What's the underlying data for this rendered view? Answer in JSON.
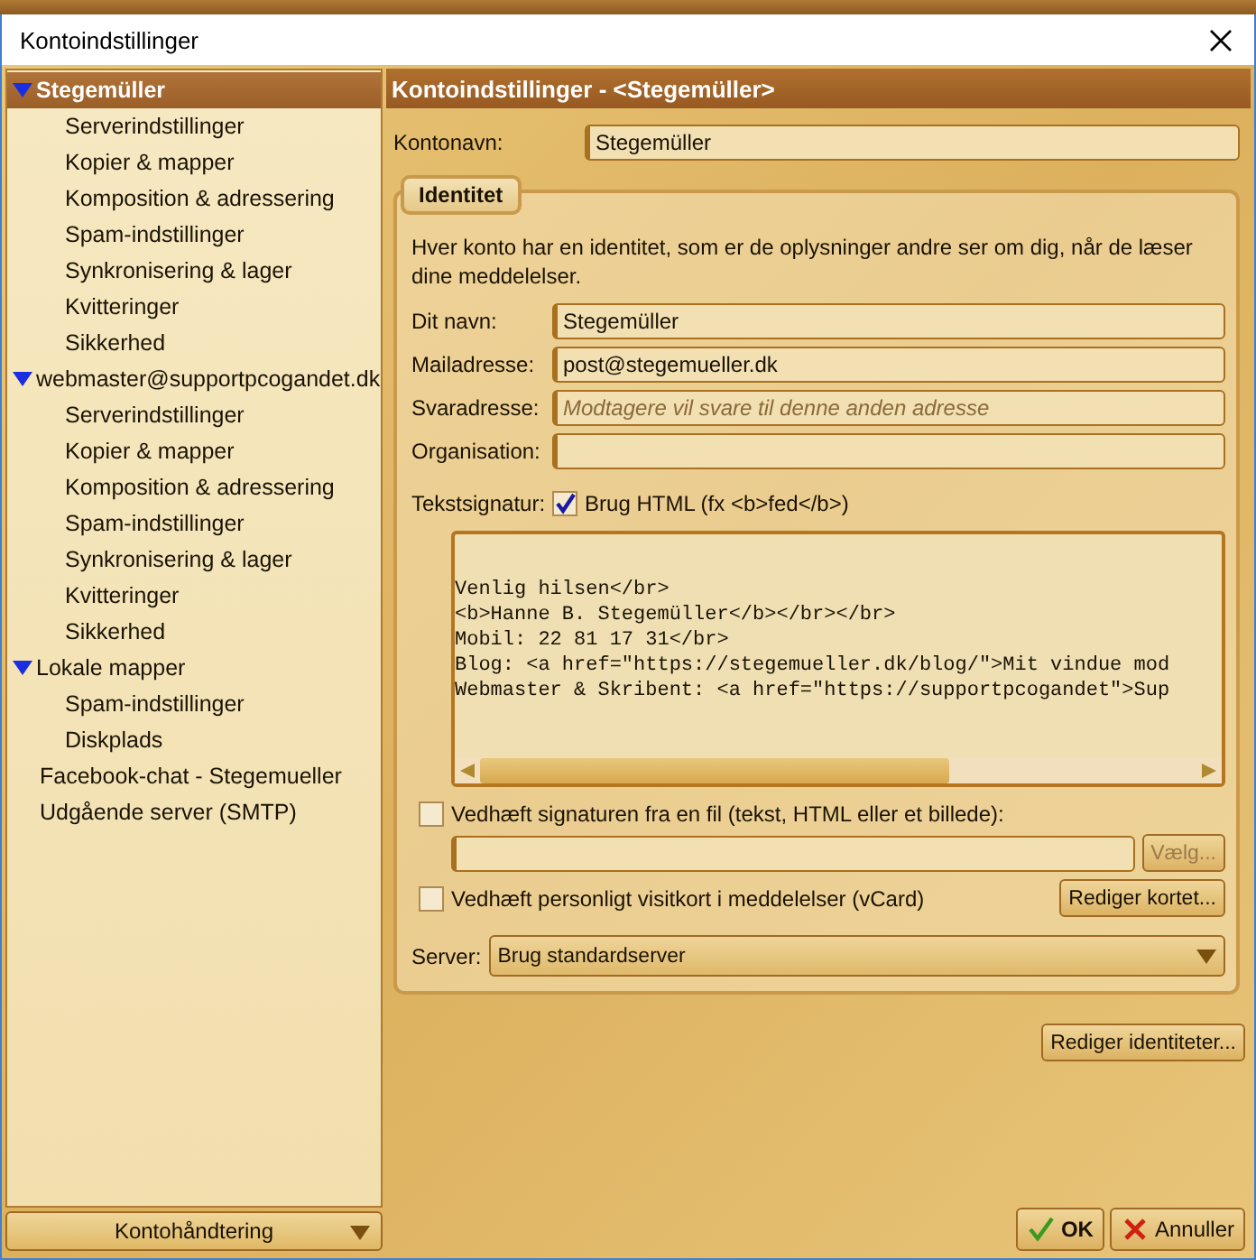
{
  "window": {
    "title": "Kontoindstillinger"
  },
  "sidebar": {
    "tree": [
      {
        "label": "Stegemüller",
        "expanded": true,
        "selected": true,
        "children": [
          {
            "label": "Serverindstillinger",
            "selected": false
          },
          {
            "label": "Kopier & mapper",
            "selected": false
          },
          {
            "label": "Komposition & adressering",
            "selected": false
          },
          {
            "label": "Spam-indstillinger",
            "selected": false
          },
          {
            "label": "Synkronisering & lager",
            "selected": false
          },
          {
            "label": "Kvitteringer",
            "selected": false
          },
          {
            "label": "Sikkerhed",
            "selected": false
          }
        ]
      },
      {
        "label": "webmaster@supportpcogandet.dk",
        "expanded": true,
        "selected": false,
        "children": [
          {
            "label": "Serverindstillinger",
            "selected": false
          },
          {
            "label": "Kopier & mapper",
            "selected": false
          },
          {
            "label": "Komposition & adressering",
            "selected": false
          },
          {
            "label": "Spam-indstillinger",
            "selected": false
          },
          {
            "label": "Synkronisering & lager",
            "selected": false
          },
          {
            "label": "Kvitteringer",
            "selected": false
          },
          {
            "label": "Sikkerhed",
            "selected": false
          }
        ]
      },
      {
        "label": "Lokale mapper",
        "expanded": true,
        "selected": false,
        "children": [
          {
            "label": "Spam-indstillinger",
            "selected": false
          },
          {
            "label": "Diskplads",
            "selected": false
          }
        ]
      },
      {
        "label": "Facebook-chat - Stegemueller",
        "selected": false
      },
      {
        "label": "Udgående server (SMTP)",
        "selected": false
      }
    ],
    "account_actions": "Kontohåndtering"
  },
  "panel": {
    "header": "Kontoindstillinger - <Stegemüller>",
    "account_name": {
      "label": "Kontonavn:",
      "value": "Stegemüller"
    },
    "identity": {
      "legend": "Identitet",
      "description": "Hver konto har en identitet, som er de oplysninger andre ser om dig, når de læser dine meddelelser.",
      "fields": [
        {
          "label": "Dit navn:",
          "value": "Stegemüller"
        },
        {
          "label": "Mailadresse:",
          "value": "post@stegemueller.dk"
        },
        {
          "label": "Svaradresse:",
          "placeholder": "Modtagere vil svare til denne anden adresse"
        },
        {
          "label": "Organisation:"
        }
      ],
      "signature_label": "Tekstsignatur:",
      "use_html": {
        "label": "Brug HTML (fx <b>fed</b>)",
        "checked": true
      },
      "signature_lines": [
        "Venlig hilsen</br>",
        "<b>Hanne B. Stegemüller</b></br></br>",
        "Mobil: 22 81 17 31</br>",
        "Blog: <a href=\"https://stegemueller.dk/blog/\">Mit vindue mod",
        "Webmaster & Skribent: <a href=\"https://supportpcogandet\">Sup"
      ],
      "attach_file": {
        "label": "Vedhæft signaturen fra en fil (tekst, HTML eller et billede):",
        "checked": false
      },
      "choose_button": {
        "label": "Vælg...",
        "disabled": true
      },
      "attach_vcard": {
        "label": "Vedhæft personligt visitkort i meddelelser (vCard)",
        "checked": false
      },
      "edit_card_button": "Rediger kortet...",
      "server": {
        "label": "Server:",
        "value": "Brug standardserver"
      }
    },
    "edit_identities_button": "Rediger identiteter..."
  },
  "buttons": {
    "ok": "OK",
    "cancel": "Annuller"
  }
}
